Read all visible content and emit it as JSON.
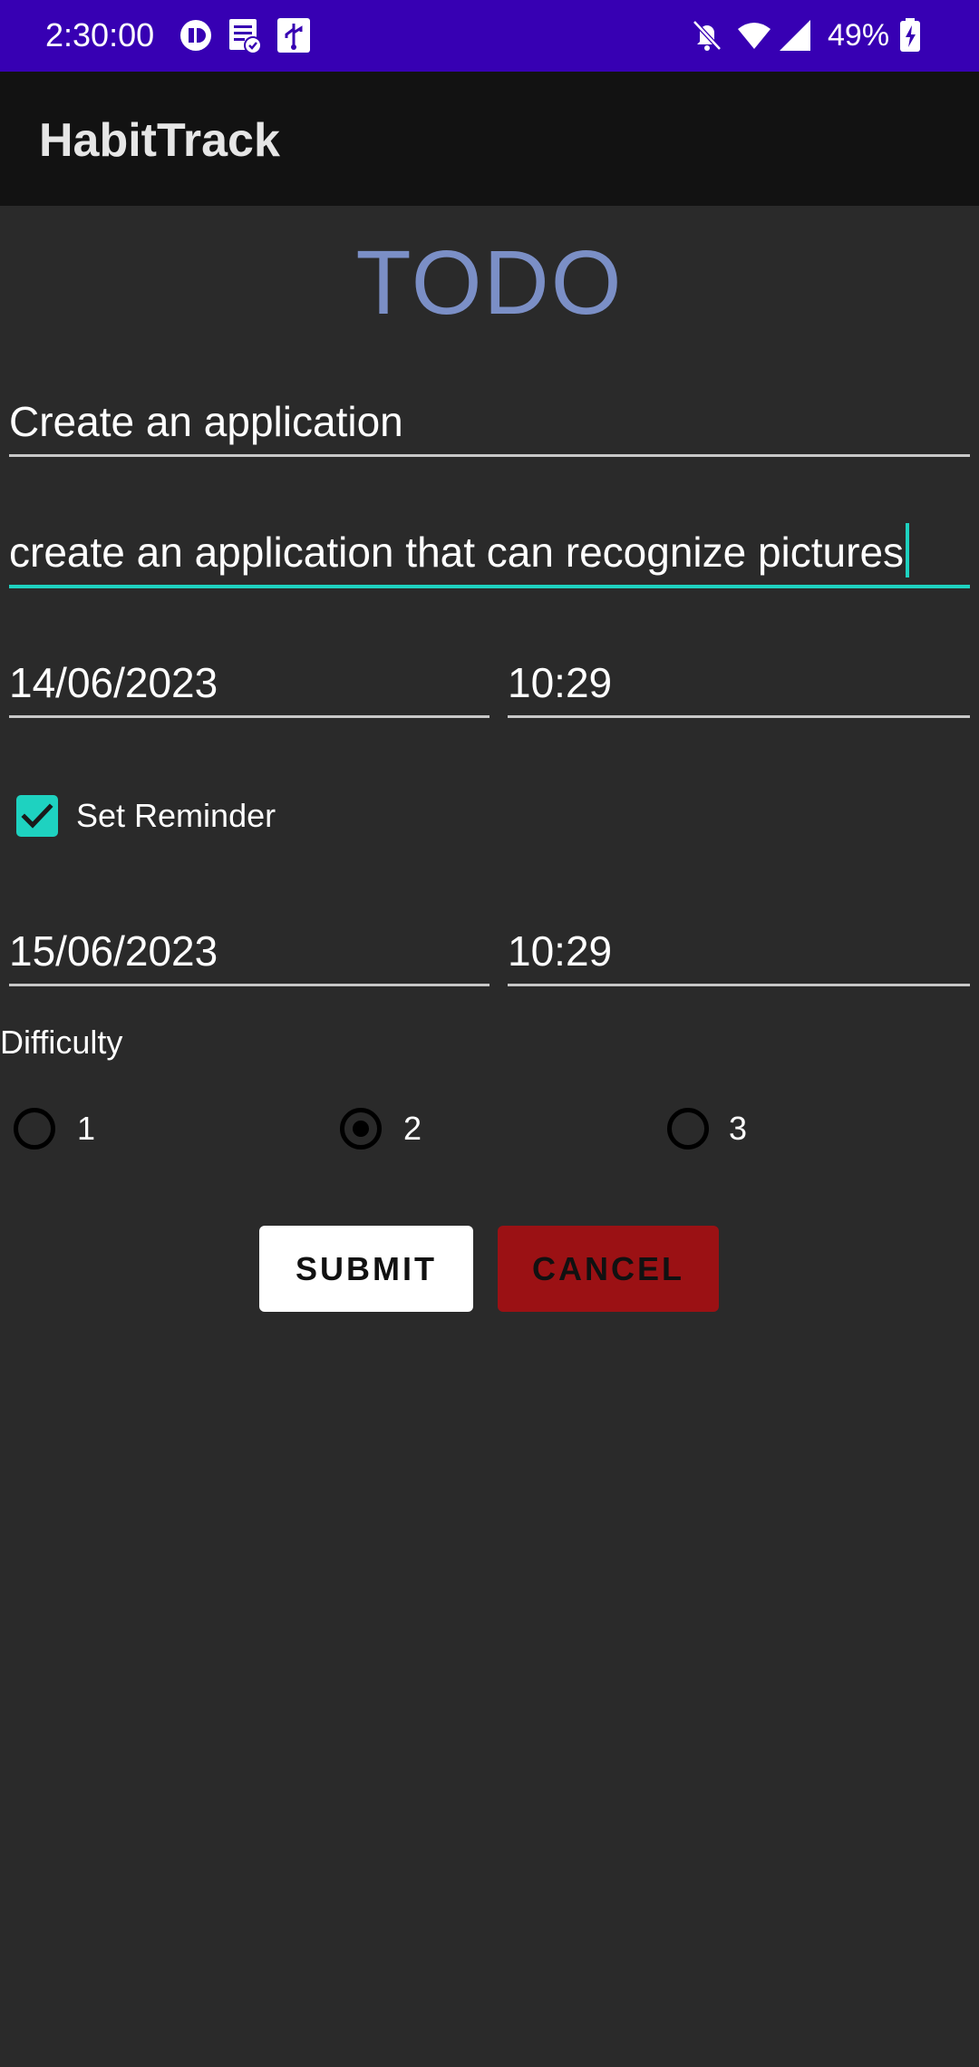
{
  "status_bar": {
    "time": "2:30:00",
    "battery": "49%",
    "icons": [
      "app-icon",
      "task-icon",
      "usb-icon",
      "mute-icon",
      "wifi-icon",
      "signal-icon",
      "battery-charging-icon"
    ],
    "background_color": "#3700b3"
  },
  "app_bar": {
    "title": "HabitTrack"
  },
  "form": {
    "heading": "TODO",
    "title_value": "Create an application",
    "description_value": "create an application that can recognize pictures",
    "start_date": "14/06/2023",
    "start_time": "10:29",
    "reminder_label": "Set Reminder",
    "reminder_checked": true,
    "reminder_date": "15/06/2023",
    "reminder_time": "10:29",
    "difficulty_label": "Difficulty",
    "difficulty_options": [
      "1",
      "2",
      "3"
    ],
    "difficulty_selected": "2"
  },
  "buttons": {
    "submit_label": "SUBMIT",
    "cancel_label": "CANCEL"
  },
  "colors": {
    "accent": "#1ed2c0",
    "heading": "#7b8fc6",
    "cancel": "#9b1114"
  }
}
